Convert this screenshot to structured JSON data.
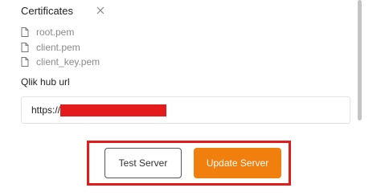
{
  "certificates": {
    "title": "Certificates",
    "close_icon": "close-icon",
    "files": [
      {
        "name": "root.pem",
        "icon": "file-icon"
      },
      {
        "name": "client.pem",
        "icon": "file-icon"
      },
      {
        "name": "client_key.pem",
        "icon": "file-icon"
      }
    ]
  },
  "hub_url": {
    "label": "Qlik hub url",
    "value": "https://"
  },
  "actions": {
    "test_label": "Test Server",
    "update_label": "Update Server"
  },
  "colors": {
    "accent": "#f07f0e",
    "highlight": "#e31b1b"
  }
}
